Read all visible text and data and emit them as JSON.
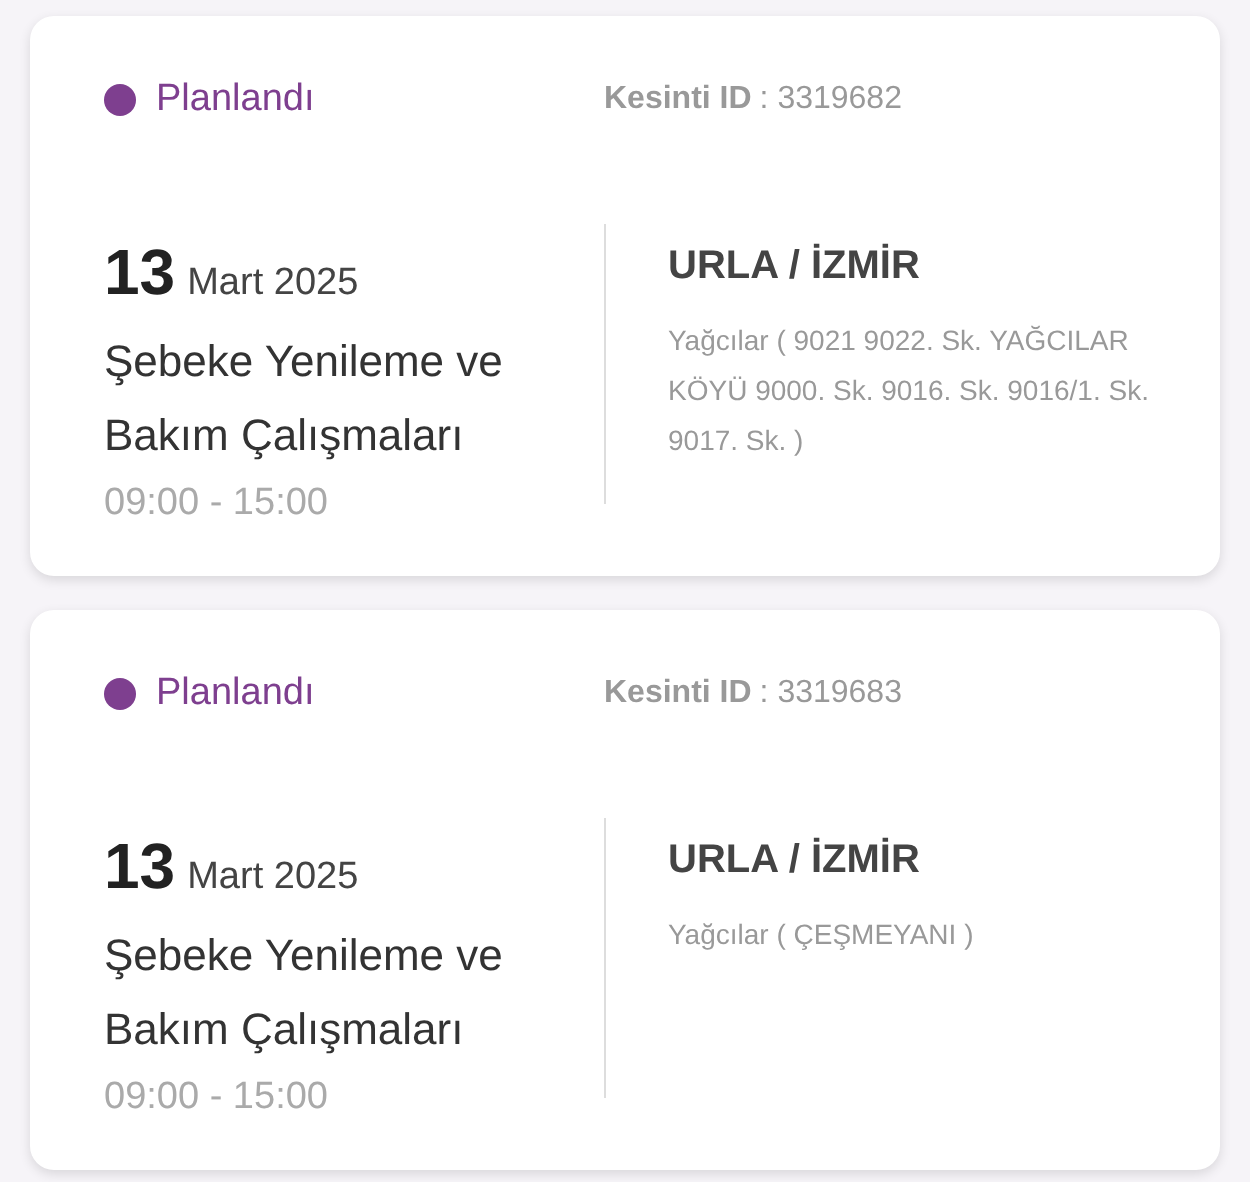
{
  "outages": [
    {
      "status": {
        "label": "Planlandı",
        "color": "#7e3f8f"
      },
      "id_label": "Kesinti ID",
      "id_value": ": 3319682",
      "day": "13",
      "month_year": "Mart 2025",
      "title": "Şebeke Yenileme ve Bakım Çalışmaları",
      "time": "09:00 - 15:00",
      "location": "URLA / İZMİR",
      "address": "Yağcılar ( 9021 9022. Sk. YAĞCILAR KÖYÜ 9000. Sk. 9016. Sk. 9016/1. Sk. 9017. Sk. )"
    },
    {
      "status": {
        "label": "Planlandı",
        "color": "#7e3f8f"
      },
      "id_label": "Kesinti ID",
      "id_value": ": 3319683",
      "day": "13",
      "month_year": "Mart 2025",
      "title": "Şebeke Yenileme ve Bakım Çalışmaları",
      "time": "09:00 - 15:00",
      "location": "URLA / İZMİR",
      "address": "Yağcılar ( ÇEŞMEYANI )"
    }
  ]
}
